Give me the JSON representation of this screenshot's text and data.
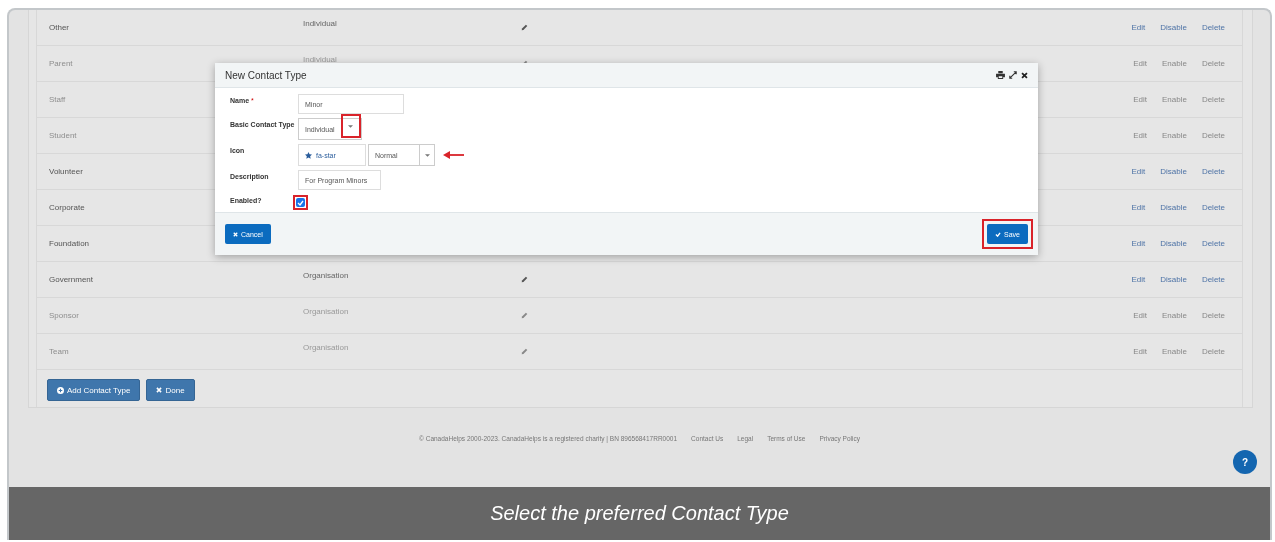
{
  "table": {
    "rows": [
      {
        "name": "Other",
        "type": "Individual",
        "enabled": true,
        "actions": [
          "Edit",
          "Disable",
          "Delete"
        ]
      },
      {
        "name": "Parent",
        "type": "Individual",
        "enabled": false,
        "actions": [
          "Edit",
          "Enable",
          "Delete"
        ]
      },
      {
        "name": "Staff",
        "enabled": false,
        "actions": [
          "Edit",
          "Enable",
          "Delete"
        ]
      },
      {
        "name": "Student",
        "enabled": false,
        "actions": [
          "Edit",
          "Enable",
          "Delete"
        ]
      },
      {
        "name": "Volunteer",
        "enabled": true,
        "actions": [
          "Edit",
          "Disable",
          "Delete"
        ]
      },
      {
        "name": "Corporate",
        "enabled": true,
        "actions": [
          "Edit",
          "Disable",
          "Delete"
        ]
      },
      {
        "name": "Foundation",
        "enabled": true,
        "actions": [
          "Edit",
          "Disable",
          "Delete"
        ]
      },
      {
        "name": "Government",
        "type": "Organisation",
        "enabled": true,
        "actions": [
          "Edit",
          "Disable",
          "Delete"
        ]
      },
      {
        "name": "Sponsor",
        "type": "Organisation",
        "enabled": false,
        "actions": [
          "Edit",
          "Enable",
          "Delete"
        ]
      },
      {
        "name": "Team",
        "type": "Organisation",
        "enabled": false,
        "actions": [
          "Edit",
          "Enable",
          "Delete"
        ]
      }
    ],
    "buttons": [
      {
        "kind": "add",
        "label": "Add Contact Type"
      },
      {
        "kind": "done",
        "label": "Done"
      }
    ]
  },
  "modal": {
    "title": "New Contact Type",
    "fields": [
      {
        "kind": "text",
        "label": "Name",
        "required_mark": "*",
        "value": "Minor"
      },
      {
        "kind": "select",
        "label": "Basic Contact Type",
        "value": "Individual",
        "highlighted": true
      },
      {
        "kind": "icon",
        "label": "Icon",
        "value": "fa-star",
        "style": "Normal",
        "pointer": true
      },
      {
        "kind": "text",
        "label": "Description",
        "value": "For Program Minors"
      },
      {
        "kind": "checkbox",
        "label": "Enabled?",
        "checked": true,
        "highlighted": true
      }
    ],
    "cancel": {
      "label": "Cancel"
    },
    "save": {
      "label": "Save",
      "highlighted": true
    }
  },
  "footer": {
    "copyright": "© CanadaHelps 2000-2023. CanadaHelps is a registered charity | BN 896568417RR0001",
    "links": [
      "Contact Us",
      "Legal",
      "Terms of Use",
      "Privacy Policy"
    ]
  },
  "help": {
    "label": "?"
  },
  "caption": "Select the preferred Contact Type"
}
